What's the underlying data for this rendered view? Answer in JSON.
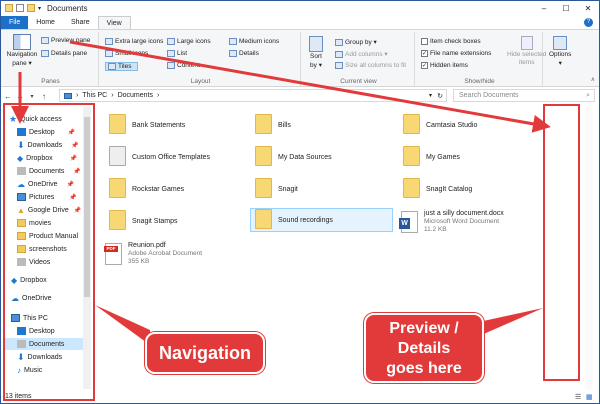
{
  "window": {
    "title": "Documents",
    "controls": [
      "–",
      "☐",
      "✕"
    ]
  },
  "ribbon_tabs": [
    "File",
    "Home",
    "Share",
    "View"
  ],
  "ribbon": {
    "panes": {
      "navigation_pane": "Navigation",
      "navigation_pane2": "pane ▾",
      "preview_pane": "Preview pane",
      "details_pane": "Details pane",
      "group_label": "Panes"
    },
    "layout": {
      "items": [
        "Extra large icons",
        "Large icons",
        "Medium icons",
        "Small icons",
        "List",
        "Details",
        "Tiles",
        "Content"
      ],
      "group_label": "Layout"
    },
    "current_view": {
      "sort_by": "Sort",
      "sort_by2": "by ▾",
      "group_by": "Group by ▾",
      "add_columns": "Add columns ▾",
      "size_columns": "Size all columns to fit",
      "group_label": "Current view"
    },
    "show_hide": {
      "item_check_boxes": "Item check boxes",
      "file_name_extensions": "File name extensions",
      "hidden_items": "Hidden items",
      "hide_selected": "Hide selected",
      "hide_selected2": "items",
      "group_label": "Show/hide"
    },
    "options": "Options",
    "options2": "▾"
  },
  "address": {
    "crumbs": [
      "This PC",
      "›",
      "Documents",
      "›"
    ],
    "search_placeholder": "Search Documents"
  },
  "nav": {
    "quick_access": "Quick access",
    "quick_items": [
      "Desktop",
      "Downloads",
      "Dropbox",
      "Documents",
      "OneDrive",
      "Pictures",
      "Google Drive",
      "movies",
      "Product Manual",
      "screenshots",
      "Videos"
    ],
    "dropbox": "Dropbox",
    "onedrive": "OneDrive",
    "this_pc": "This PC",
    "pc_items": [
      "Desktop",
      "Documents",
      "Downloads",
      "Music"
    ],
    "status": "13 items"
  },
  "files": [
    {
      "name": "Bank Statements",
      "kind": "folder"
    },
    {
      "name": "Bills",
      "kind": "folder"
    },
    {
      "name": "Camtasia Studio",
      "kind": "folder"
    },
    {
      "name": "Custom Office Templates",
      "kind": "folder"
    },
    {
      "name": "My Data Sources",
      "kind": "folder"
    },
    {
      "name": "My Games",
      "kind": "folder"
    },
    {
      "name": "Rockstar Games",
      "kind": "folder"
    },
    {
      "name": "Snagit",
      "kind": "folder"
    },
    {
      "name": "SnagIt Catalog",
      "kind": "folder"
    },
    {
      "name": "Snagit Stamps",
      "kind": "folder"
    },
    {
      "name": "Sound recordings",
      "kind": "folder"
    },
    {
      "name": "just a silly document.docx",
      "kind": "word",
      "sub1": "Microsoft Word Document",
      "sub2": "11.2 KB"
    },
    {
      "name": "Reunion.pdf",
      "kind": "pdf",
      "sub1": "Adobe Acrobat Document",
      "sub2": "355 KB"
    }
  ],
  "callouts": {
    "navigation": "Navigation",
    "preview": "Preview /",
    "preview2": "Details",
    "preview3": "goes here"
  },
  "colors": {
    "accent": "#1e6fc8",
    "annotation": "#e23a3a"
  }
}
